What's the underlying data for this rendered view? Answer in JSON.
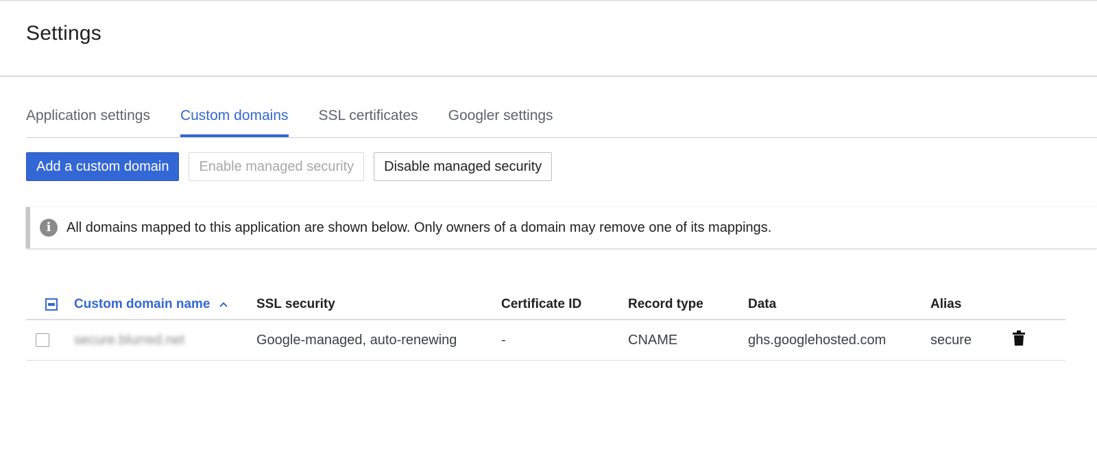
{
  "header": {
    "title": "Settings"
  },
  "tabs": [
    {
      "label": "Application settings",
      "active": false
    },
    {
      "label": "Custom domains",
      "active": true
    },
    {
      "label": "SSL certificates",
      "active": false
    },
    {
      "label": "Googler settings",
      "active": false
    }
  ],
  "actions": {
    "add_label": "Add a custom domain",
    "enable_label": "Enable managed security",
    "disable_label": "Disable managed security"
  },
  "info": {
    "icon": "info-icon",
    "text": "All domains mapped to this application are shown below. Only owners of a domain may remove one of its mappings."
  },
  "table": {
    "columns": [
      "Custom domain name",
      "SSL security",
      "Certificate ID",
      "Record type",
      "Data",
      "Alias"
    ],
    "sort_indicator": "^",
    "rows": [
      {
        "domain": "secure.blurred.net",
        "ssl": "Google-managed, auto-renewing",
        "cert_id": "-",
        "record_type": "CNAME",
        "data": "ghs.googlehosted.com",
        "alias": "secure"
      }
    ]
  },
  "colors": {
    "accent": "#3367d6",
    "text": "#212121",
    "muted": "#5f6368",
    "disabled": "#a8a8a8"
  }
}
